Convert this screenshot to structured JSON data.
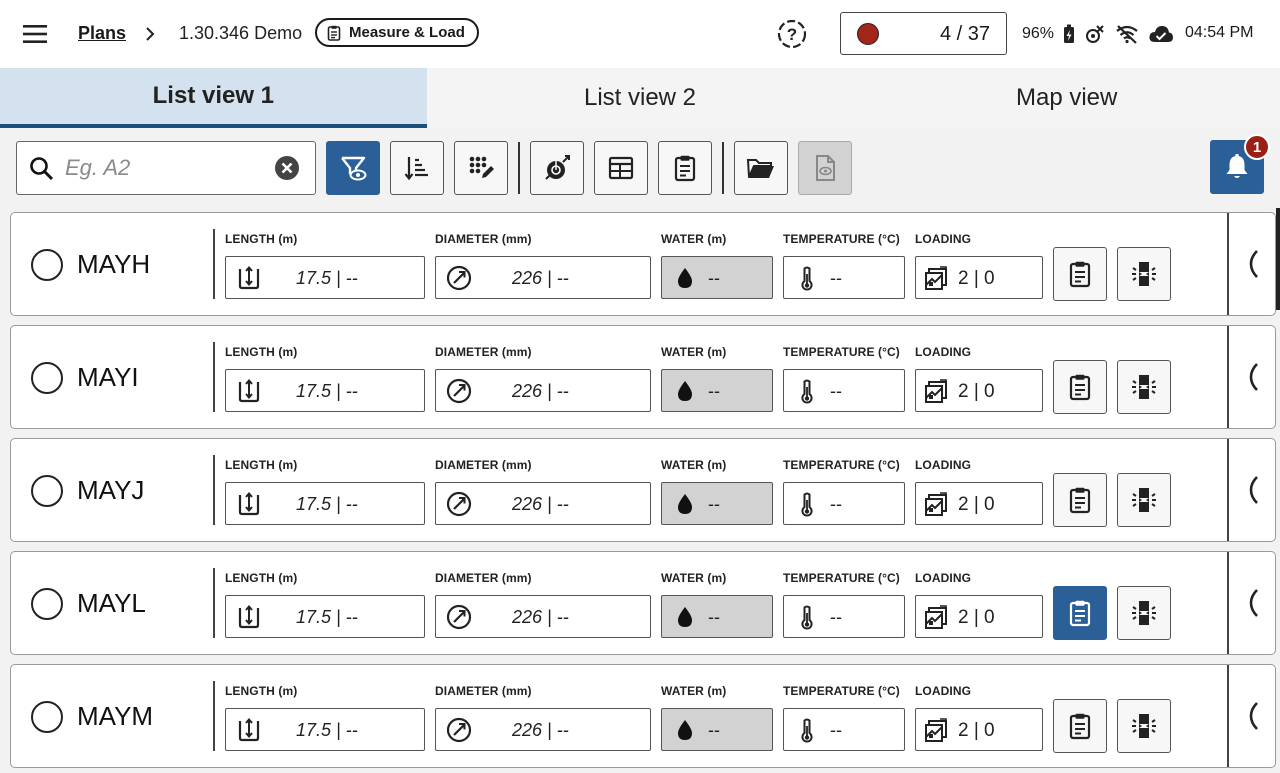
{
  "header": {
    "breadcrumb_plans": "Plans",
    "version": "1.30.346 Demo",
    "mode_label": "Measure & Load",
    "counter": "4 / 37",
    "battery": "96%",
    "time": "04:54 PM"
  },
  "tabs": [
    {
      "label": "List view 1",
      "active": true
    },
    {
      "label": "List view 2",
      "active": false
    },
    {
      "label": "Map view",
      "active": false
    }
  ],
  "toolbar": {
    "search_placeholder": "Eg. A2",
    "notification_count": "1"
  },
  "fields": {
    "length_label": "LENGTH (m)",
    "diameter_label": "DIAMETER (mm)",
    "water_label": "WATER (m)",
    "temperature_label": "TEMPERATURE (°C)",
    "loading_label": "LOADING"
  },
  "rows": [
    {
      "id": "MAYH",
      "length": "17.5 | --",
      "diameter": "226 | --",
      "water": "--",
      "temperature": "--",
      "loading": "2 | 0",
      "notes_active": false
    },
    {
      "id": "MAYI",
      "length": "17.5 | --",
      "diameter": "226 | --",
      "water": "--",
      "temperature": "--",
      "loading": "2 | 0",
      "notes_active": false
    },
    {
      "id": "MAYJ",
      "length": "17.5 | --",
      "diameter": "226 | --",
      "water": "--",
      "temperature": "--",
      "loading": "2 | 0",
      "notes_active": false
    },
    {
      "id": "MAYL",
      "length": "17.5 | --",
      "diameter": "226 | --",
      "water": "--",
      "temperature": "--",
      "loading": "2 | 0",
      "notes_active": true
    },
    {
      "id": "MAYM",
      "length": "17.5 | --",
      "diameter": "226 | --",
      "water": "--",
      "temperature": "--",
      "loading": "2 | 0",
      "notes_active": false
    }
  ],
  "colors": {
    "primary": "#2a5f97",
    "tab_active_bg": "#d3e2ee",
    "badge": "#9a1f14",
    "record": "#a3261a"
  }
}
